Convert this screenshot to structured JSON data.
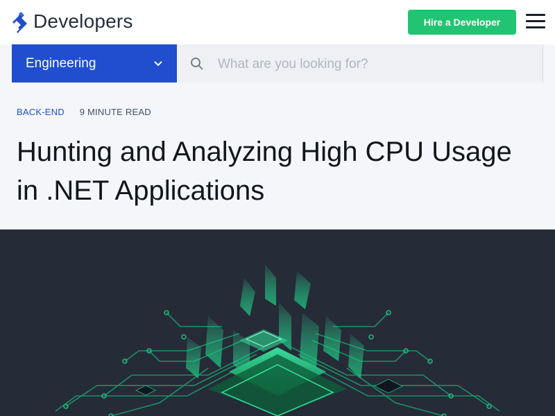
{
  "header": {
    "brand": "Developers",
    "hire_label": "Hire a Developer",
    "logo_icon": "toptal-logo-icon",
    "menu_icon": "hamburger-menu-icon"
  },
  "nav": {
    "category_label": "Engineering",
    "chevron_icon": "chevron-down-icon",
    "search_icon": "search-icon",
    "search_placeholder": "What are you looking for?"
  },
  "article": {
    "category": "BACK-END",
    "read_time": "9 MINUTE READ",
    "title": "Hunting and Analyzing High CPU Usage in .NET Applications"
  },
  "hero": {
    "image_icon": "cpu-circuit-illustration"
  },
  "colors": {
    "brand_blue": "#204ecf",
    "hire_green": "#20c472",
    "hero_bg": "#262b38",
    "circuit_green": "#2ee59d"
  }
}
